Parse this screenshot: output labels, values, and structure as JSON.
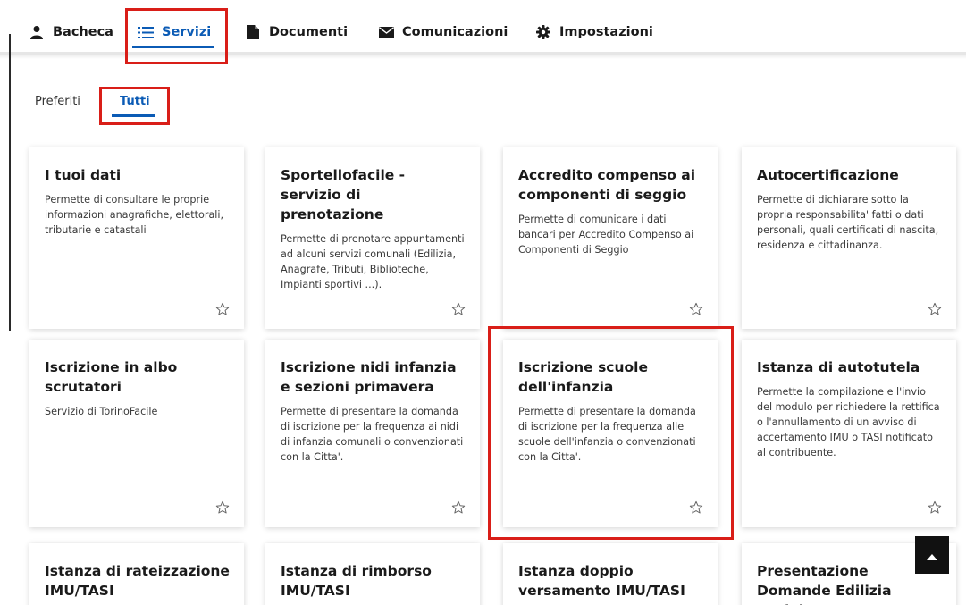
{
  "nav": {
    "bacheca": "Bacheca",
    "servizi": "Servizi",
    "documenti": "Documenti",
    "comunicazioni": "Comunicazioni",
    "impostazioni": "Impostazioni"
  },
  "subtabs": {
    "preferiti": "Preferiti",
    "tutti": "Tutti"
  },
  "cards": [
    {
      "title": "I tuoi dati",
      "desc": "Permette di consultare le proprie informazioni anagrafiche, elettorali, tributarie e catastali"
    },
    {
      "title": "Sportellofacile - servizio di prenotazione",
      "desc": "Permette di prenotare appuntamenti ad alcuni servizi comunali (Edilizia, Anagrafe, Tributi, Biblioteche, Impianti sportivi ...)."
    },
    {
      "title": "Accredito compenso ai componenti di seggio",
      "desc": "Permette di comunicare i dati bancari per Accredito Compenso ai Componenti di Seggio"
    },
    {
      "title": "Autocertificazione",
      "desc": "Permette di dichiarare sotto la propria responsabilita' fatti o dati personali, quali certificati di nascita, residenza e cittadinanza."
    },
    {
      "title": "Iscrizione in albo scrutatori",
      "desc": "Servizio di TorinoFacile"
    },
    {
      "title": "Iscrizione nidi infanzia e sezioni primavera",
      "desc": "Permette di presentare la domanda di iscrizione per la frequenza ai nidi di infanzia comunali o convenzionati con la Citta'."
    },
    {
      "title": "Iscrizione scuole dell'infanzia",
      "desc": "Permette di presentare la domanda di iscrizione per la frequenza alle scuole dell'infanzia o convenzionati con la Citta'."
    },
    {
      "title": "Istanza di autotutela",
      "desc": "Permette la compilazione e l'invio del modulo per richiedere la rettifica o l'annullamento di un avviso di accertamento IMU o TASI notificato al contribuente."
    },
    {
      "title": "Istanza di rateizzazione IMU/TASI",
      "desc": ""
    },
    {
      "title": "Istanza di rimborso IMU/TASI",
      "desc": ""
    },
    {
      "title": "Istanza doppio versamento IMU/TASI",
      "desc": ""
    },
    {
      "title": "Presentazione Domande Edilizia Sociale",
      "desc": ""
    }
  ],
  "colors": {
    "accent": "#0b5bb5",
    "highlight": "#d91e18"
  }
}
